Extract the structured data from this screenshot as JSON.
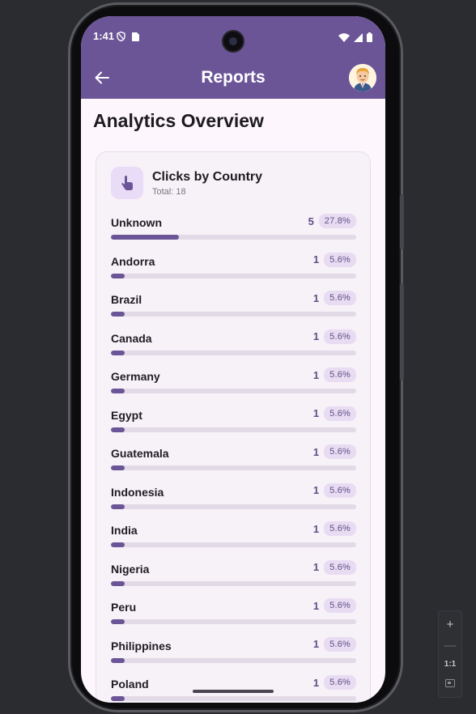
{
  "status_bar": {
    "time": "1:41"
  },
  "app_bar": {
    "title": "Reports"
  },
  "page": {
    "title": "Analytics Overview"
  },
  "card": {
    "title": "Clicks by Country",
    "subtitle": "Total: 18",
    "rows": [
      {
        "name": "Unknown",
        "count": "5",
        "percent": "27.8%",
        "fraction": 0.278
      },
      {
        "name": "Andorra",
        "count": "1",
        "percent": "5.6%",
        "fraction": 0.056
      },
      {
        "name": "Brazil",
        "count": "1",
        "percent": "5.6%",
        "fraction": 0.056
      },
      {
        "name": "Canada",
        "count": "1",
        "percent": "5.6%",
        "fraction": 0.056
      },
      {
        "name": "Germany",
        "count": "1",
        "percent": "5.6%",
        "fraction": 0.056
      },
      {
        "name": "Egypt",
        "count": "1",
        "percent": "5.6%",
        "fraction": 0.056
      },
      {
        "name": "Guatemala",
        "count": "1",
        "percent": "5.6%",
        "fraction": 0.056
      },
      {
        "name": "Indonesia",
        "count": "1",
        "percent": "5.6%",
        "fraction": 0.056
      },
      {
        "name": "India",
        "count": "1",
        "percent": "5.6%",
        "fraction": 0.056
      },
      {
        "name": "Nigeria",
        "count": "1",
        "percent": "5.6%",
        "fraction": 0.056
      },
      {
        "name": "Peru",
        "count": "1",
        "percent": "5.6%",
        "fraction": 0.056
      },
      {
        "name": "Philippines",
        "count": "1",
        "percent": "5.6%",
        "fraction": 0.056
      },
      {
        "name": "Poland",
        "count": "1",
        "percent": "5.6%",
        "fraction": 0.056
      }
    ]
  },
  "zoom_controls": {
    "reset_label": "1:1"
  },
  "colors": {
    "primary": "#6b5597",
    "background": "#fdf6fd",
    "card": "#f7f1f8",
    "track": "#e2dbe7",
    "pill": "#e8dcf3"
  },
  "icons": [
    "back-arrow-icon",
    "touch-icon",
    "avatar",
    "wifi-icon",
    "signal-icon",
    "battery-icon",
    "shield-icon",
    "sim-icon"
  ]
}
